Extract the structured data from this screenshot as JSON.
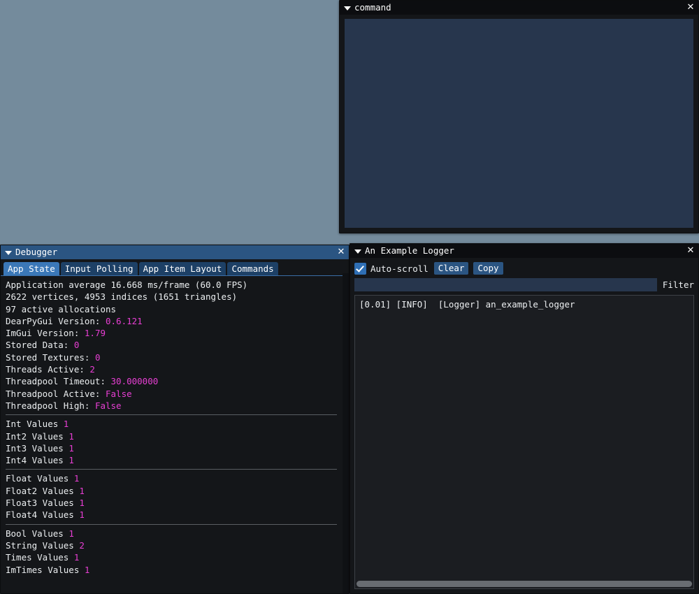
{
  "desktop": {
    "background": "#748b9c"
  },
  "windows": {
    "command": {
      "title": "command",
      "collapse_icon": "triangle-down-icon",
      "close_icon": "close-icon",
      "input_value": "",
      "input_placeholder": ""
    },
    "debugger": {
      "title": "Debugger",
      "collapse_icon": "triangle-down-icon",
      "close_icon": "close-icon",
      "tabs": [
        {
          "label": "App State",
          "active": true
        },
        {
          "label": "Input Polling",
          "active": false
        },
        {
          "label": "App Item Layout",
          "active": false
        },
        {
          "label": "Commands",
          "active": false
        }
      ],
      "stats": {
        "frame_line": "Application average 16.668 ms/frame (60.0 FPS)",
        "geometry_line": "2622 vertices, 4953 indices (1651 triangles)",
        "allocations_line": "97 active allocations"
      },
      "versions": [
        {
          "label": "DearPyGui Version: ",
          "value": "0.6.121"
        },
        {
          "label": "ImGui Version: ",
          "value": "1.79"
        },
        {
          "label": "Stored Data: ",
          "value": "0"
        },
        {
          "label": "Stored Textures: ",
          "value": "0"
        },
        {
          "label": "Threads Active: ",
          "value": "2"
        },
        {
          "label": "Threadpool Timeout: ",
          "value": "30.000000"
        },
        {
          "label": "Threadpool Active: ",
          "value": "False"
        },
        {
          "label": "Threadpool High: ",
          "value": "False"
        }
      ],
      "int_values": [
        {
          "label": "Int Values ",
          "value": "1"
        },
        {
          "label": "Int2 Values ",
          "value": "1"
        },
        {
          "label": "Int3 Values ",
          "value": "1"
        },
        {
          "label": "Int4 Values ",
          "value": "1"
        }
      ],
      "float_values": [
        {
          "label": "Float Values ",
          "value": "1"
        },
        {
          "label": "Float2 Values ",
          "value": "1"
        },
        {
          "label": "Float3 Values ",
          "value": "1"
        },
        {
          "label": "Float4 Values ",
          "value": "1"
        }
      ],
      "other_values": [
        {
          "label": "Bool Values ",
          "value": "1"
        },
        {
          "label": "String Values ",
          "value": "2"
        },
        {
          "label": "Times Values ",
          "value": "1"
        },
        {
          "label": "ImTimes Values ",
          "value": "1"
        }
      ],
      "value_color": "#e83fd4"
    },
    "logger": {
      "title": "An Example Logger",
      "collapse_icon": "triangle-down-icon",
      "close_icon": "close-icon",
      "autoscroll_checked": true,
      "autoscroll_label": "Auto-scroll",
      "clear_label": "Clear",
      "copy_label": "Copy",
      "filter_value": "",
      "filter_label": "Filter",
      "log_lines": [
        "[0.01] [INFO]  [Logger] an_example_logger"
      ]
    }
  }
}
